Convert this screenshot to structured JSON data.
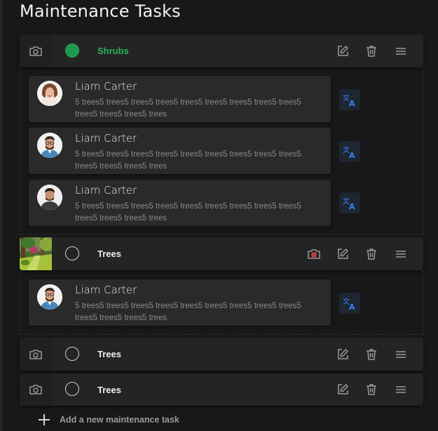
{
  "page": {
    "title": "Maintenance Tasks"
  },
  "tasks": [
    {
      "name": "Shrubs",
      "completed": true,
      "has_photo": false
    },
    {
      "name": "Trees",
      "completed": false,
      "has_photo": true
    },
    {
      "name": "Trees",
      "completed": false,
      "has_photo": false
    },
    {
      "name": "Trees",
      "completed": false,
      "has_photo": false
    }
  ],
  "notes_shrubs": [
    {
      "author": "Liam Carter",
      "text": "5 trees5 trees5 trees5 trees5 trees5 trees5 trees5 trees5 trees5 trees5 trees5 trees5 trees"
    },
    {
      "author": "Liam Carter",
      "text": "5 trees5 trees5 trees5 trees5 trees5 trees5 trees5 trees5 trees5 trees5 trees5 trees5 trees"
    },
    {
      "author": "Liam Carter",
      "text": "5 trees5 trees5 trees5 trees5 trees5 trees5 trees5 trees5 trees5 trees5 trees5 trees5 trees"
    }
  ],
  "notes_trees": [
    {
      "author": "Liam Carter",
      "text": "5 trees5 trees5 trees5 trees5 trees5 trees5 trees5 trees5 trees5 trees5 trees5 trees5 trees"
    }
  ],
  "add_task": {
    "label": "Add a new maintenance task"
  },
  "colors": {
    "done": "#1e9a4e",
    "done_text": "#27b35a",
    "translate": "#3b82f6",
    "no_photo": "#e04545"
  }
}
